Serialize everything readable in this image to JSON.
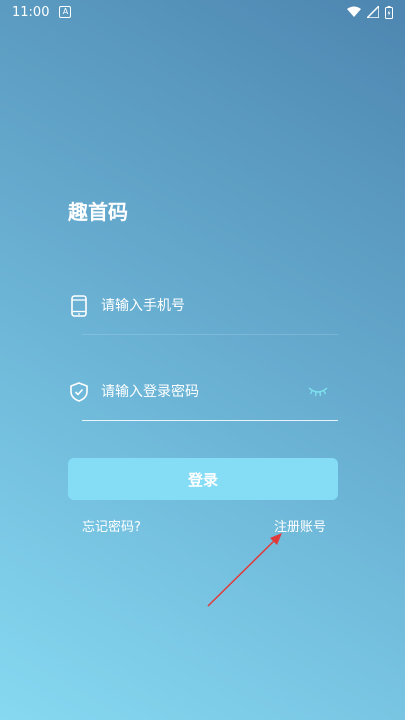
{
  "status_bar": {
    "time": "11:00"
  },
  "app": {
    "title": "趣首码"
  },
  "phone_input": {
    "placeholder": "请输入手机号",
    "value": ""
  },
  "password_input": {
    "placeholder": "请输入登录密码",
    "value": ""
  },
  "login_button": {
    "label": "登录"
  },
  "links": {
    "forgot_password": "忘记密码?",
    "register": "注册账号"
  },
  "colors": {
    "background_top": "#4d86b0",
    "background_bottom": "#86d9f1",
    "button": "#84dcf5",
    "eye_icon": "#7fe3ef",
    "arrow_annotation": "#e03a3a"
  }
}
